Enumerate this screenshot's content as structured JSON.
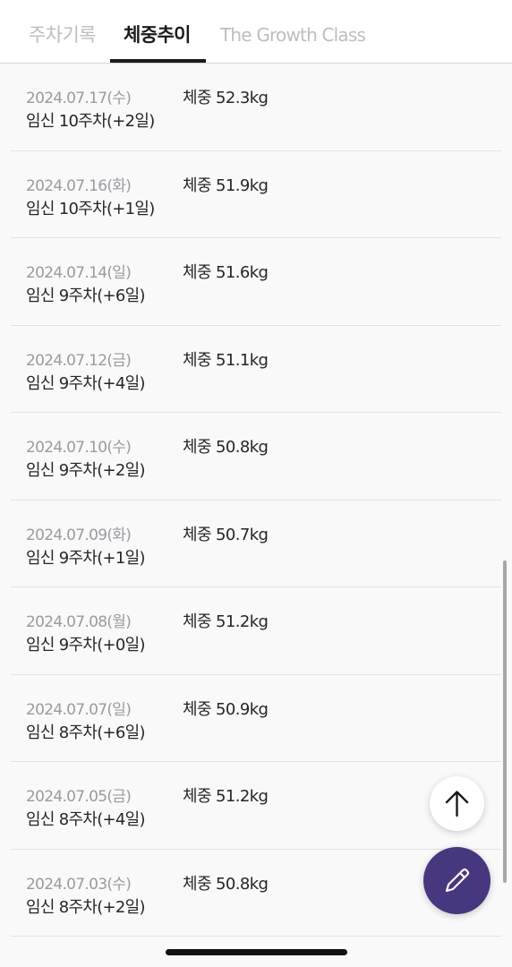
{
  "tabs": [
    {
      "label": "주차기록",
      "active": false
    },
    {
      "label": "체중추이",
      "active": true
    },
    {
      "label": "The Growth Class",
      "active": false
    }
  ],
  "records": [
    {
      "date": "2024.07.17(수)",
      "week": "임신 10주차(+2일)",
      "weight": "체중 52.3kg"
    },
    {
      "date": "2024.07.16(화)",
      "week": "임신 10주차(+1일)",
      "weight": "체중 51.9kg"
    },
    {
      "date": "2024.07.14(일)",
      "week": "임신 9주차(+6일)",
      "weight": "체중 51.6kg"
    },
    {
      "date": "2024.07.12(금)",
      "week": "임신 9주차(+4일)",
      "weight": "체중 51.1kg"
    },
    {
      "date": "2024.07.10(수)",
      "week": "임신 9주차(+2일)",
      "weight": "체중 50.8kg"
    },
    {
      "date": "2024.07.09(화)",
      "week": "임신 9주차(+1일)",
      "weight": "체중 50.7kg"
    },
    {
      "date": "2024.07.08(월)",
      "week": "임신 9주차(+0일)",
      "weight": "체중 51.2kg"
    },
    {
      "date": "2024.07.07(일)",
      "week": "임신 8주차(+6일)",
      "weight": "체중 50.9kg"
    },
    {
      "date": "2024.07.05(금)",
      "week": "임신 8주차(+4일)",
      "weight": "체중 51.2kg"
    },
    {
      "date": "2024.07.03(수)",
      "week": "임신 8주차(+2일)",
      "weight": "체중 50.8kg"
    }
  ],
  "buttons": {
    "scroll_top_icon": "arrow-up-icon",
    "edit_icon": "pencil-icon"
  },
  "colors": {
    "accent": "#46377e",
    "background": "#f9f9fa"
  }
}
